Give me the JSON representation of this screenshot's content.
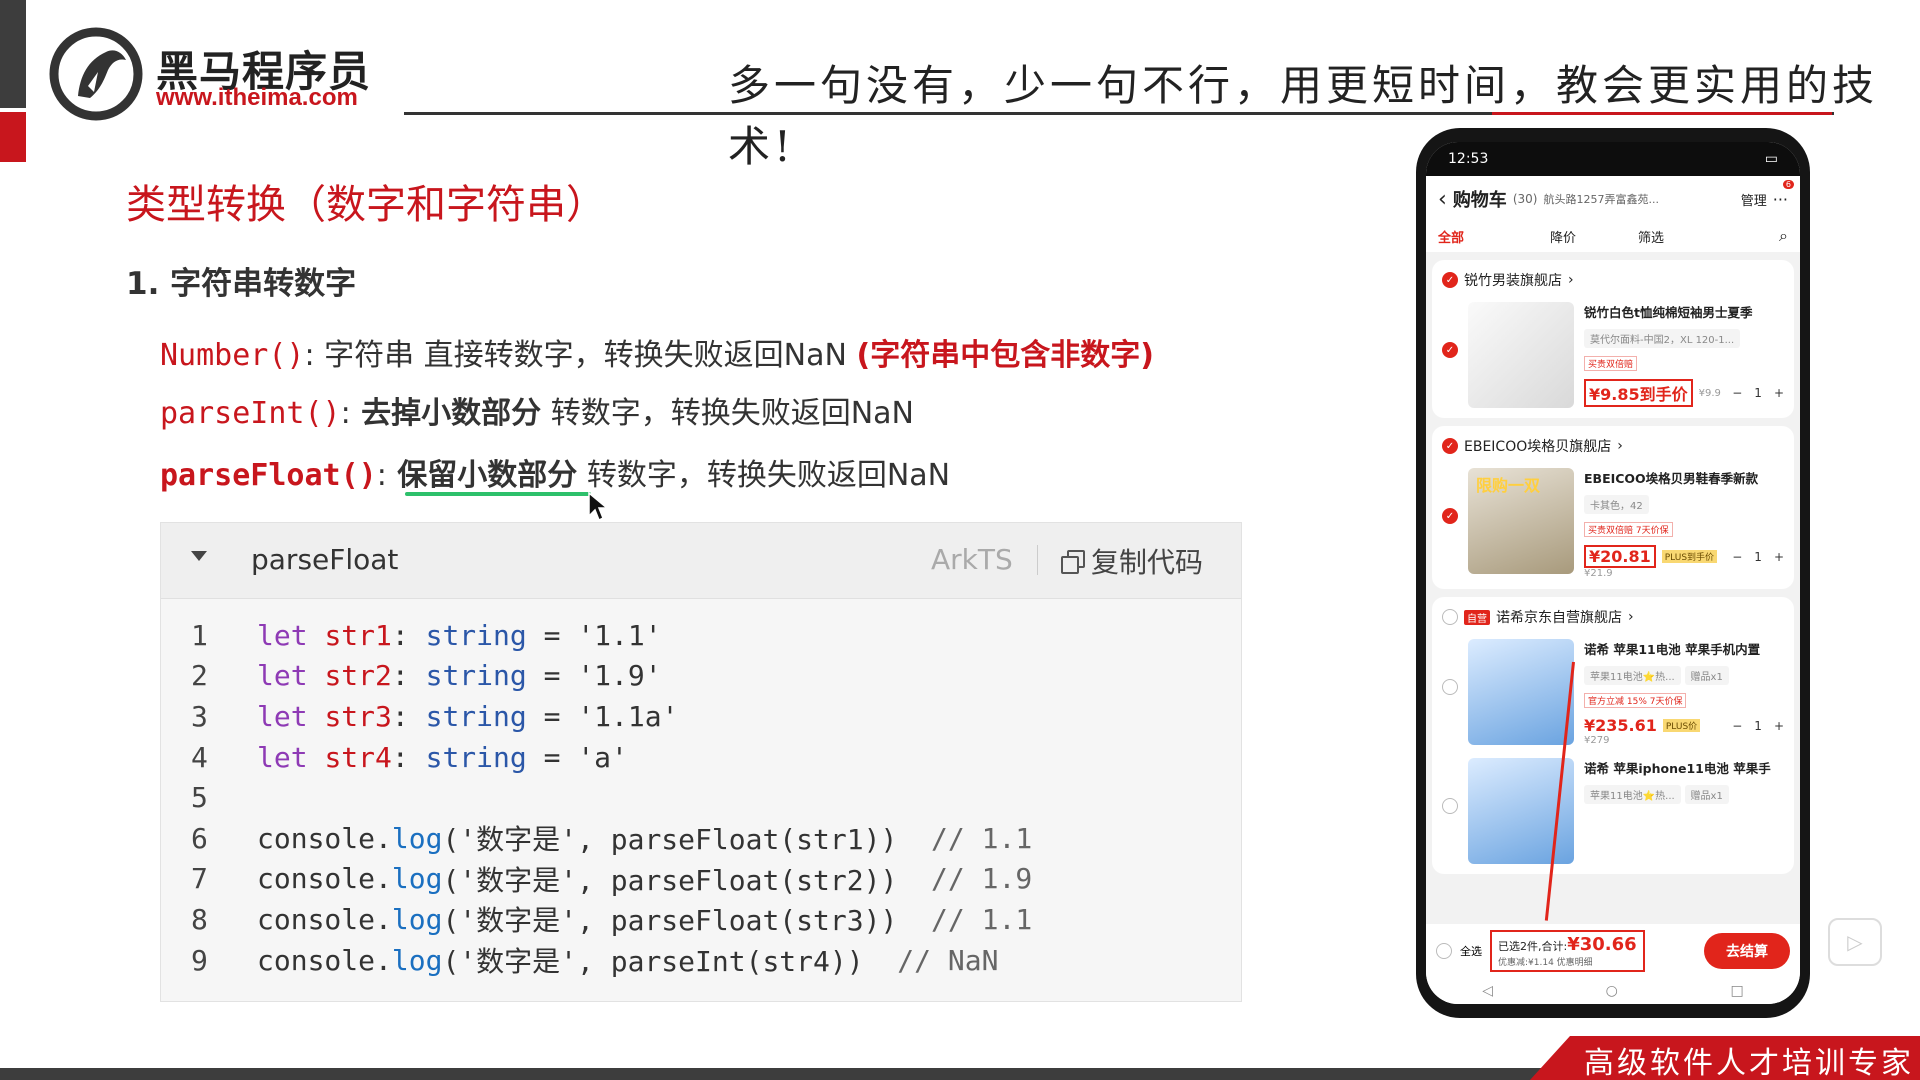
{
  "header": {
    "brand_name": "黑马程序员",
    "brand_url": "www.itheima.com",
    "slogan": "多一句没有，少一句不行，用更短时间，教会更实用的技术!"
  },
  "slide": {
    "section_title": "类型转换（数字和字符串）",
    "sub_title": "1. 字符串转数字",
    "api_lines": [
      {
        "fn": "Number()",
        "sep": ":",
        "text_a": " 字符串 直接转数字，转换失败返回NaN ",
        "text_red": "(字符串中包含非数字)"
      },
      {
        "fn": "parseInt()",
        "sep": ":",
        "text_bold": " 去掉小数部分",
        "text_b": " 转数字，转换失败返回NaN"
      },
      {
        "fn": "parseFloat()",
        "sep": ":",
        "text_bold": " 保留小数部分",
        "text_b": " 转数字，转换失败返回NaN"
      }
    ]
  },
  "code_panel": {
    "title": "parseFloat",
    "lang": "ArkTS",
    "copy_label": "复制代码",
    "lines": [
      {
        "n": "1",
        "kw": "let ",
        "var": "str1",
        "p1": ": ",
        "typ": "string",
        "p2": " = ",
        "str": "'1.1'"
      },
      {
        "n": "2",
        "kw": "let ",
        "var": "str2",
        "p1": ": ",
        "typ": "string",
        "p2": " = ",
        "str": "'1.9'"
      },
      {
        "n": "3",
        "kw": "let ",
        "var": "str3",
        "p1": ": ",
        "typ": "string",
        "p2": " = ",
        "str": "'1.1a'"
      },
      {
        "n": "4",
        "kw": "let ",
        "var": "str4",
        "p1": ": ",
        "typ": "string",
        "p2": " = ",
        "str": "'a'"
      },
      {
        "n": "5"
      },
      {
        "n": "6",
        "obj": "console.",
        "fnc": "log",
        "args": "('数字是', parseFloat(str1))",
        "cmt": "  // 1.1"
      },
      {
        "n": "7",
        "obj": "console.",
        "fnc": "log",
        "args": "('数字是', parseFloat(str2))",
        "cmt": "  // 1.9"
      },
      {
        "n": "8",
        "obj": "console.",
        "fnc": "log",
        "args": "('数字是', parseFloat(str3))",
        "cmt": "  // 1.1"
      },
      {
        "n": "9",
        "obj": "console.",
        "fnc": "log",
        "args": "('数字是', parseInt(str4))",
        "cmt": "  // NaN"
      }
    ]
  },
  "phone": {
    "time": "12:53",
    "nav_title": "购物车",
    "nav_count": "(30)",
    "nav_addr": "航头路1257弄富鑫苑...",
    "nav_manage": "管理",
    "badge": "6",
    "tabs": [
      "全部",
      "降价",
      "筛选"
    ],
    "stores": [
      {
        "name": "锐竹男装旗舰店",
        "item_name": "锐竹白色t恤纯棉短袖男士夏季",
        "spec": "莫代尔面料-中国2，XL 120-1...",
        "tag": "买贵双倍赔",
        "price": "¥9.85到手价",
        "orig": "¥9.9",
        "qty": "1"
      },
      {
        "name": "EBEICOO埃格贝旗舰店",
        "item_name": "EBEICOO埃格贝男鞋春季新款",
        "spec": "卡其色，42",
        "tag": "买贵双倍赔  7天价保",
        "price": "¥20.81",
        "plus": "PLUS到手价",
        "orig": "¥21.9",
        "qty": "1",
        "thumb_label": "限购一双"
      },
      {
        "name": "诺希京东自营旗舰店",
        "self_tag": "自营",
        "item_name": "诺希 苹果11电池 苹果手机内置",
        "spec": "苹果11电池⭐热...",
        "tag": "官方立减 15%  7天价保",
        "price": "¥235.61",
        "plus": "PLUS价",
        "orig": "¥279",
        "qty": "1",
        "gift": "赠品x1"
      },
      {
        "item_name": "诺希 苹果iphone11电池 苹果手",
        "spec": "苹果11电池⭐热...",
        "gift": "赠品x1"
      }
    ],
    "checkout": {
      "select_all": "全选",
      "summary": "已选2件,合计:",
      "total": "¥30.66",
      "discount": "优惠减:¥1.14  优惠明细",
      "button": "去结算"
    }
  },
  "footer": {
    "text": "高级软件人才培训专家"
  }
}
